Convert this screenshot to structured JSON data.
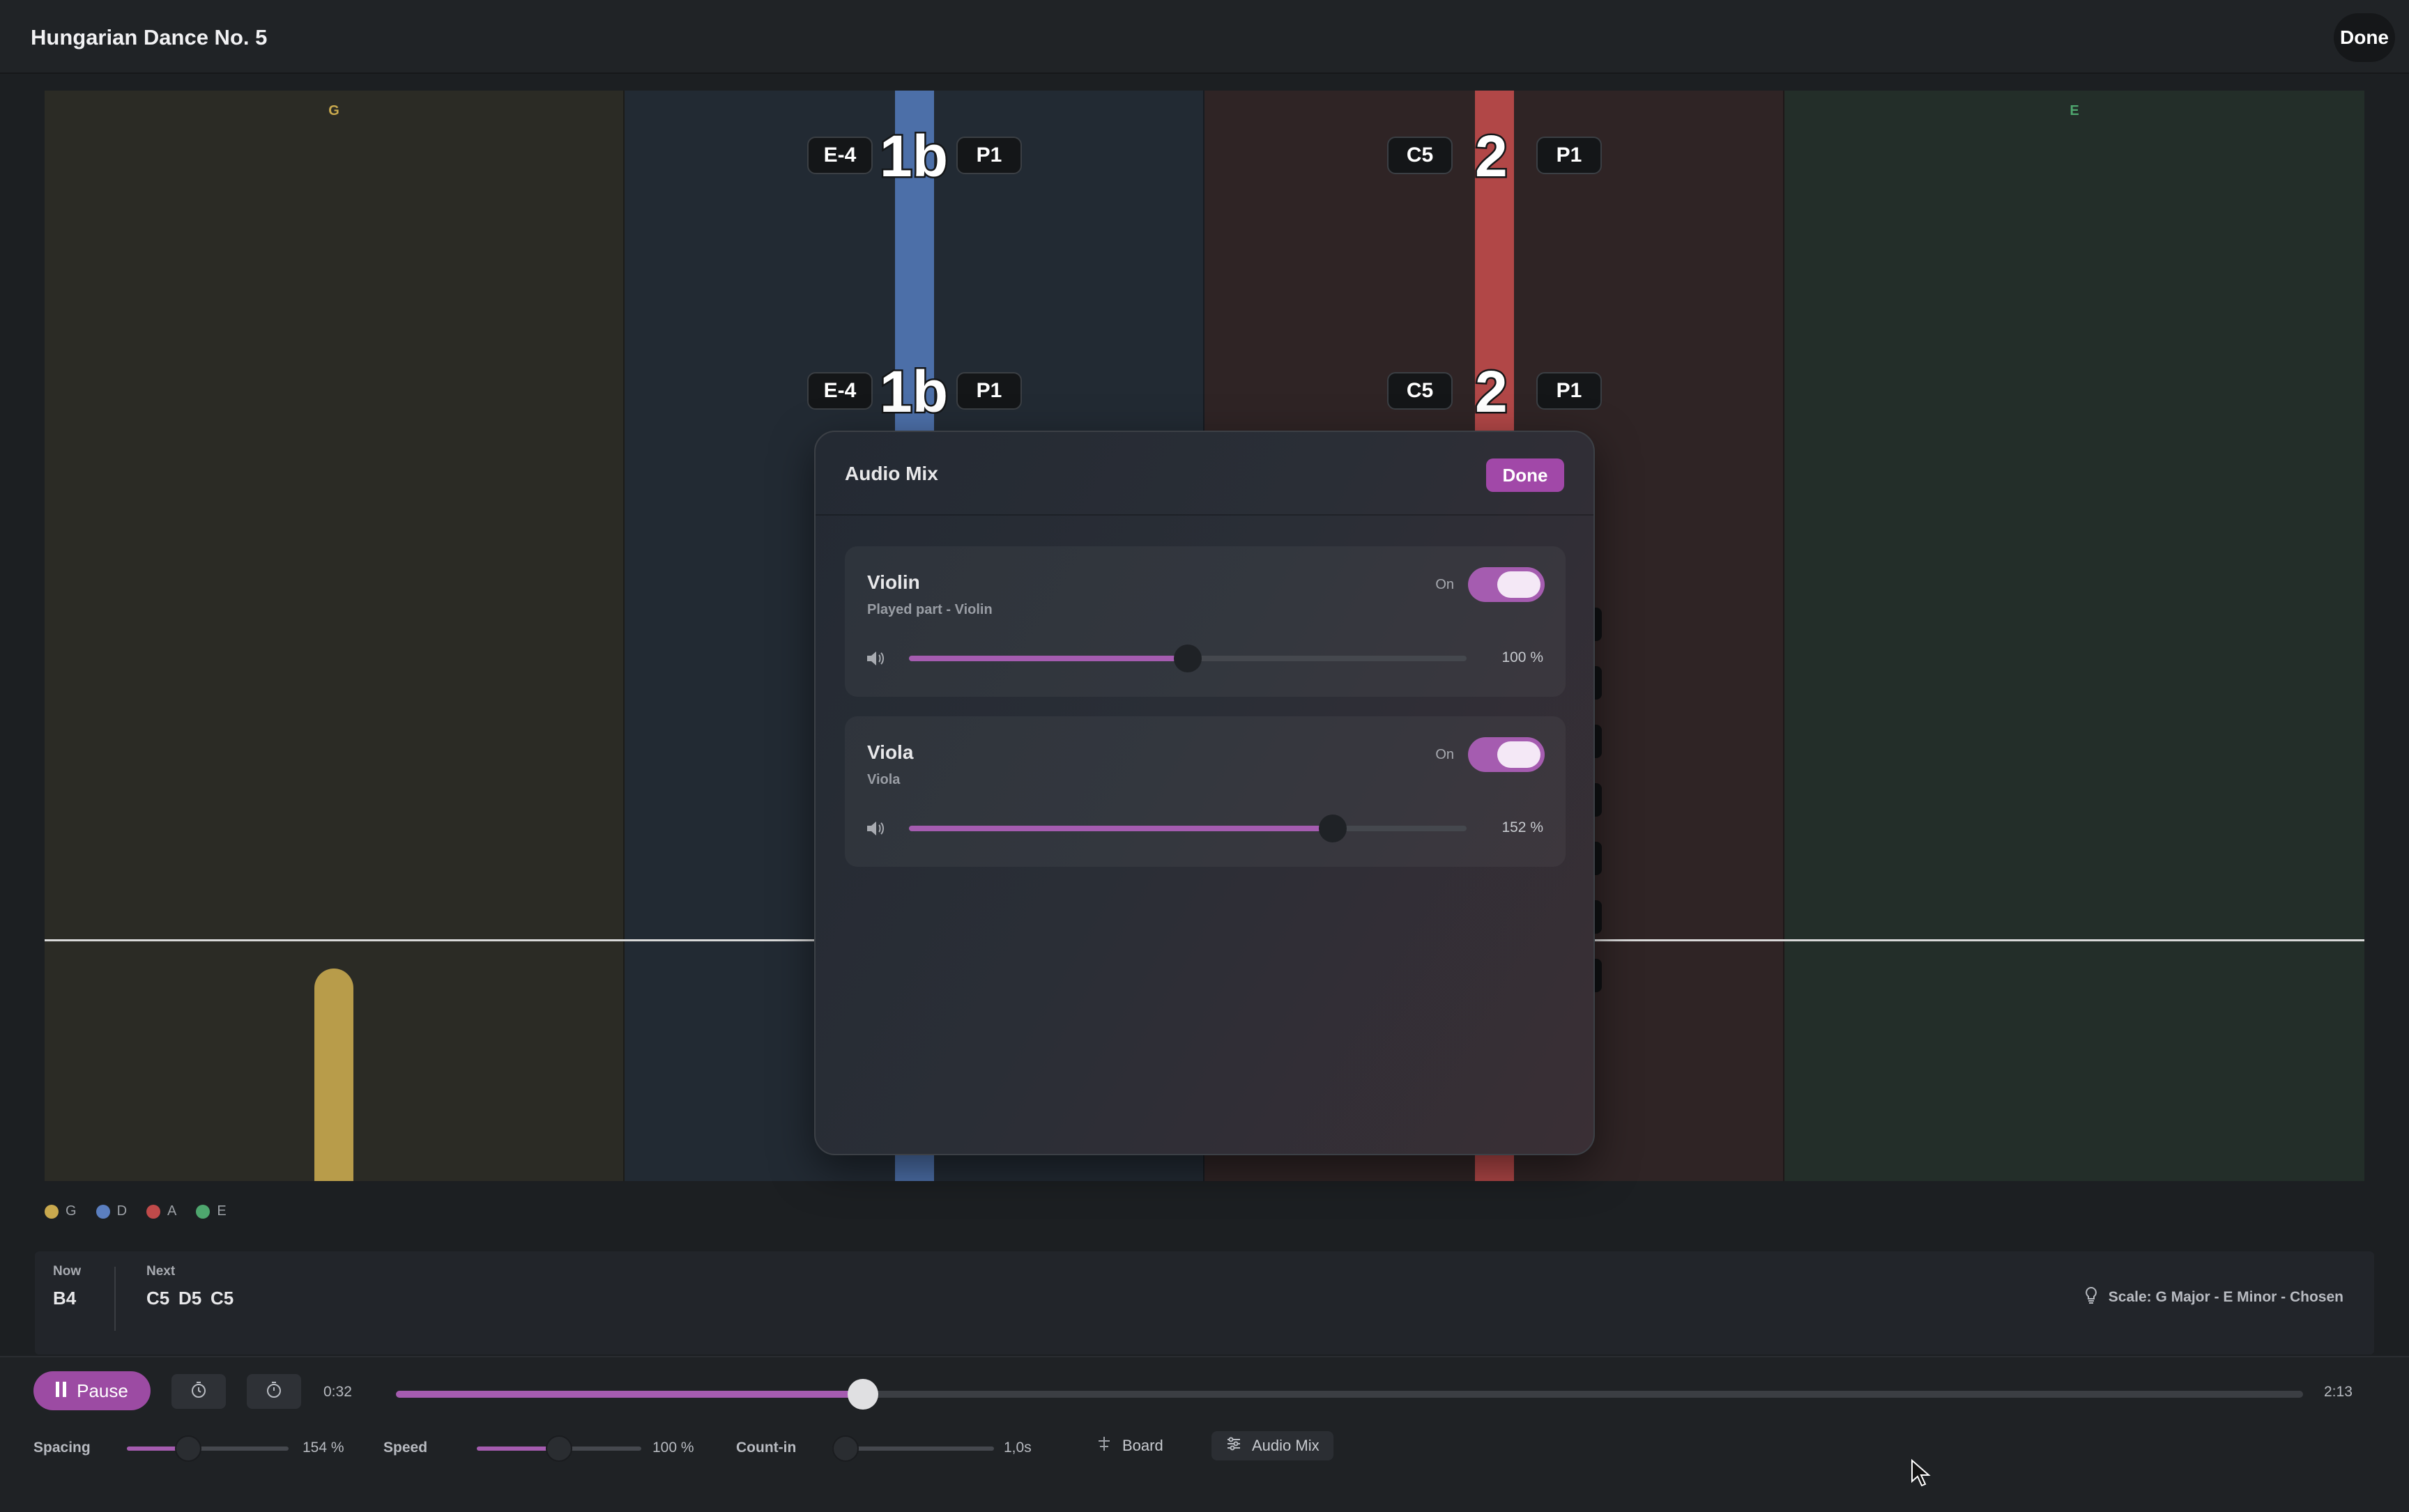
{
  "header": {
    "title": "Hungarian Dance No. 5",
    "done_label": "Done"
  },
  "board": {
    "lanes": [
      {
        "label": "G",
        "color": "#c9a94e"
      },
      {
        "label": "D",
        "color": "#5b7fc0"
      },
      {
        "label": "A",
        "color": "#c04a4a"
      },
      {
        "label": "E",
        "color": "#4ea66e"
      }
    ],
    "notes": [
      {
        "left": "E-4",
        "finger": "1b",
        "right": "P1"
      },
      {
        "left": "C5",
        "finger": "2",
        "right": "P1"
      }
    ]
  },
  "audio_mix": {
    "title": "Audio Mix",
    "done_label": "Done",
    "tracks": [
      {
        "name": "Violin",
        "subtitle": "Played part - Violin",
        "toggle_label": "On",
        "enabled": true,
        "volume_label": "100 %",
        "volume_fraction": 0.5
      },
      {
        "name": "Viola",
        "subtitle": "Viola",
        "toggle_label": "On",
        "enabled": true,
        "volume_label": "152 %",
        "volume_fraction": 0.76
      }
    ]
  },
  "legend": [
    "G",
    "D",
    "A",
    "E"
  ],
  "now_next": {
    "now_label": "Now",
    "now_value": "B4",
    "next_label": "Next",
    "next_values": [
      "C5",
      "D5",
      "C5"
    ],
    "scale_text": "Scale: G Major - E Minor - Chosen"
  },
  "transport": {
    "pause_label": "Pause",
    "current_time": "0:32",
    "total_time": "2:13",
    "progress_fraction": 0.245
  },
  "controls": {
    "spacing_label": "Spacing",
    "spacing_value": "154 %",
    "spacing_fraction": 0.38,
    "speed_label": "Speed",
    "speed_value": "100 %",
    "speed_fraction": 0.5,
    "countin_label": "Count-in",
    "countin_value": "1,0s",
    "countin_fraction": 0.08,
    "board_label": "Board",
    "audio_mix_label": "Audio Mix"
  },
  "colors": {
    "accent": "#a55cb0"
  }
}
